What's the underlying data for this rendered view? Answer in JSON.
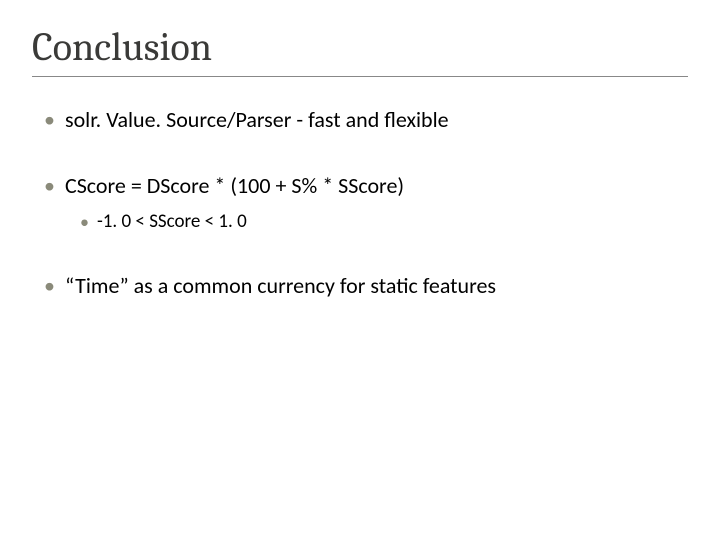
{
  "slide": {
    "title": "Conclusion",
    "bullets": [
      {
        "text": "solr. Value. Source/Parser - fast and flexible"
      },
      {
        "text": "CScore = DScore * (100 + S% * SScore)",
        "sub": "-1. 0 < SScore < 1. 0"
      },
      {
        "text": "“Time” as a common currency for static features"
      }
    ]
  }
}
